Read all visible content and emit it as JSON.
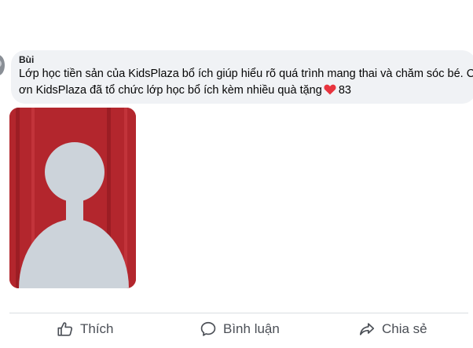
{
  "comment": {
    "author": "Bùi",
    "text_line1": "Lớp học tiền sản của KidsPlaza bổ ích giúp hiểu rõ quá trình mang thai và chăm sóc bé. Cảm",
    "text_line2": "ơn KidsPlaza đã tổ chức lớp học bổ ích kèm nhiều quà tặng",
    "reaction_icon": "heart-icon",
    "reaction_count": "83"
  },
  "actions": {
    "like_label": "Thích",
    "comment_label": "Bình luận",
    "share_label": "Chia sẻ"
  },
  "colors": {
    "bubble": "#f0f2f5",
    "heart": "#e8343e",
    "action_text": "#4b4f56"
  }
}
